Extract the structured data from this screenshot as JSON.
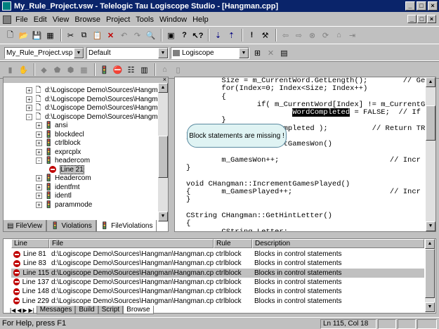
{
  "window": {
    "title": "My_Rule_Project.vsw - Telelogic Tau Logiscope Studio - [Hangman.cpp]",
    "minimize": "_",
    "maximize": "□",
    "close": "×"
  },
  "menu": [
    "File",
    "Edit",
    "View",
    "Browse",
    "Project",
    "Tools",
    "Window",
    "Help"
  ],
  "toolbar3": {
    "project_combo": "My_Rule_Project.vsp",
    "config_combo": "Default",
    "tool_combo": "Logiscope"
  },
  "tree": {
    "rows": [
      {
        "label": "d:\\Logiscope Demo\\Sources\\Hangman\\",
        "exp": "+",
        "icon": "file"
      },
      {
        "label": "d:\\Logiscope Demo\\Sources\\Hangman\\",
        "exp": "+",
        "icon": "file"
      },
      {
        "label": "d:\\Logiscope Demo\\Sources\\Hangman\\",
        "exp": "+",
        "icon": "file"
      },
      {
        "label": "d:\\Logiscope Demo\\Sources\\Hangman\\",
        "exp": "-",
        "icon": "file"
      },
      {
        "label": "ansi",
        "exp": "+",
        "icon": "rule"
      },
      {
        "label": "blockdecl",
        "exp": "+",
        "icon": "rule"
      },
      {
        "label": "ctrlblock",
        "exp": "+",
        "icon": "rule"
      },
      {
        "label": "exprcplx",
        "exp": "+",
        "icon": "rule"
      },
      {
        "label": "headercom",
        "exp": "-",
        "icon": "rule"
      },
      {
        "label": "Line 21",
        "exp": "",
        "icon": "no"
      },
      {
        "label": "Headercom",
        "exp": "+",
        "icon": "rule"
      },
      {
        "label": "identfmt",
        "exp": "+",
        "icon": "rule"
      },
      {
        "label": "identl",
        "exp": "+",
        "icon": "rule"
      },
      {
        "label": "parammode",
        "exp": "+",
        "icon": "rule"
      }
    ],
    "tabs": [
      "FileView",
      "Violations",
      "FileViolations"
    ]
  },
  "code": {
    "lines": [
      "        Size = m_CurrentWord.GetLength();        // Get",
      "        for(Index=0; Index<Size; Index++)",
      "        {",
      "                if( m_CurrentWord[Index] != m_CurrentGu",
      "                        WordCompleted = FALSE;  // If a",
      "        }",
      "        return( WordCompleted );          // Return TRUE/",
      "}",
      "                  ::GetGamesWon()",
      "",
      "        m_GamesWon++;                         // Incr",
      "}",
      "",
      "void CHangman::IncrementGamesPlayed()",
      "{       m_GamesPlayed++;                      // Incr",
      "}",
      "",
      "CString CHangman::GetHintLetter()",
      "{",
      "        CString Letter;"
    ],
    "highlighted": "WordCompleted"
  },
  "tooltip": "Block statements are missing !",
  "output": {
    "columns": [
      "Line",
      "File",
      "Rule",
      "Description"
    ],
    "rows": [
      {
        "line": "Line 81",
        "file": "d:\\Logiscope Demo\\Sources\\Hangman\\Hangman.cpp",
        "rule": "ctrlblock",
        "desc": "Blocks in control statements"
      },
      {
        "line": "Line 83",
        "file": "d:\\Logiscope Demo\\Sources\\Hangman\\Hangman.cpp",
        "rule": "ctrlblock",
        "desc": "Blocks in control statements"
      },
      {
        "line": "Line 115",
        "file": "d:\\Logiscope Demo\\Sources\\Hangman\\Hangman.cpp",
        "rule": "ctrlblock",
        "desc": "Blocks in control statements"
      },
      {
        "line": "Line 137",
        "file": "d:\\Logiscope Demo\\Sources\\Hangman\\Hangman.cpp",
        "rule": "ctrlblock",
        "desc": "Blocks in control statements"
      },
      {
        "line": "Line 148",
        "file": "d:\\Logiscope Demo\\Sources\\Hangman\\Hangman.cpp",
        "rule": "ctrlblock",
        "desc": "Blocks in control statements"
      },
      {
        "line": "Line 229",
        "file": "d:\\Logiscope Demo\\Sources\\Hangman\\Hangman.cpp",
        "rule": "ctrlblock",
        "desc": "Blocks in control statements"
      }
    ],
    "selected_index": 2,
    "tabs": [
      "Messages",
      "Build",
      "Script",
      "Browse"
    ]
  },
  "status": {
    "help": "For Help, press F1",
    "position": "Ln 115, Col 18"
  }
}
